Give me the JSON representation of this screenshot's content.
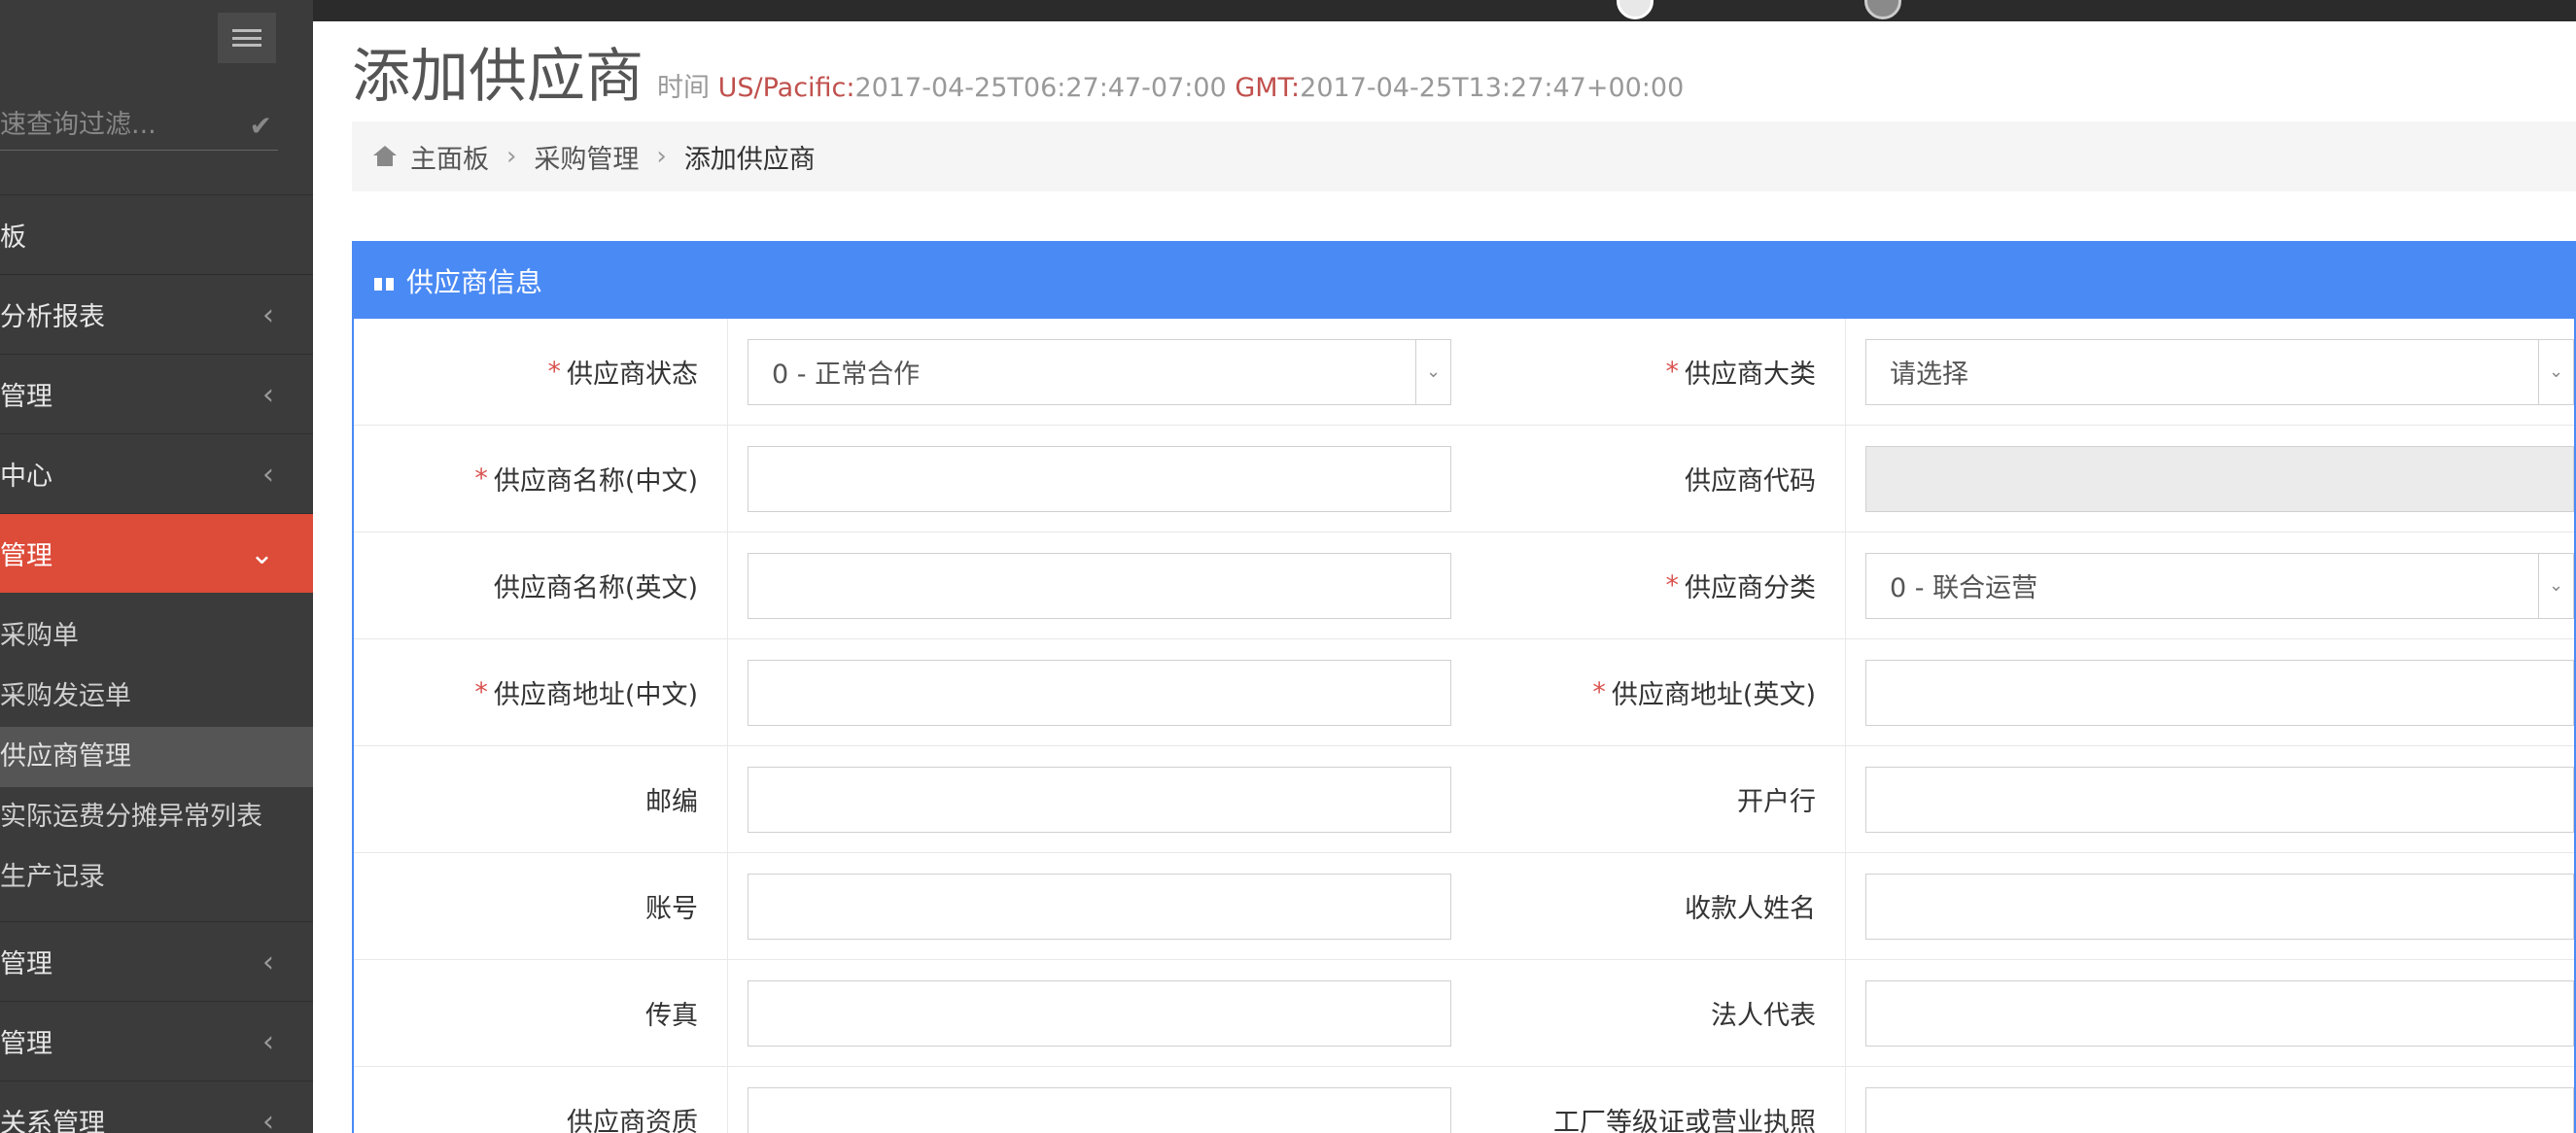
{
  "sidebar": {
    "search_placeholder": "速查询过滤...",
    "menu_top": [
      {
        "label": "板",
        "chevron": ""
      },
      {
        "label": "分析报表",
        "chevron": "‹"
      },
      {
        "label": "管理",
        "chevron": "‹"
      },
      {
        "label": "中心",
        "chevron": "‹"
      },
      {
        "label": "管理",
        "chevron": "⌄"
      }
    ],
    "submenu": [
      "采购单",
      "采购发运单",
      "供应商管理",
      "实际运费分摊异常列表",
      "生产记录"
    ],
    "menu_bottom": [
      {
        "label": "管理",
        "chevron": "‹"
      },
      {
        "label": "管理",
        "chevron": "‹"
      },
      {
        "label": "关系管理",
        "chevron": "‹"
      }
    ]
  },
  "header": {
    "title": "添加供应商",
    "time_label": "时间",
    "tz1_name": "US/Pacific:",
    "tz1_time": "2017-04-25T06:27:47-07:00",
    "tz2_name": "GMT:",
    "tz2_time": "2017-04-25T13:27:47+00:00"
  },
  "breadcrumb": {
    "home": "主面板",
    "level2": "采购管理",
    "current": "添加供应商",
    "separator": "›"
  },
  "panel": {
    "title": "供应商信息",
    "rows": [
      {
        "left_label": "供应商状态",
        "left_required": "*",
        "left_value": "0 - 正常合作",
        "right_label": "供应商大类",
        "right_required": "*",
        "right_value": "请选择"
      },
      {
        "left_label": "供应商名称(中文)",
        "left_required": "*",
        "left_value": "",
        "right_label": "供应商代码",
        "right_required": "",
        "right_value": ""
      },
      {
        "left_label": "供应商名称(英文)",
        "left_required": "",
        "left_value": "",
        "right_label": "供应商分类",
        "right_required": "*",
        "right_value": "0 - 联合运营"
      },
      {
        "left_label": "供应商地址(中文)",
        "left_required": "*",
        "left_value": "",
        "right_label": "供应商地址(英文)",
        "right_required": "*",
        "right_value": ""
      },
      {
        "left_label": "邮编",
        "left_required": "",
        "left_value": "",
        "right_label": "开户行",
        "right_required": "",
        "right_value": ""
      },
      {
        "left_label": "账号",
        "left_required": "",
        "left_value": "",
        "right_label": "收款人姓名",
        "right_required": "",
        "right_value": ""
      },
      {
        "left_label": "传真",
        "left_required": "",
        "left_value": "",
        "right_label": "法人代表",
        "right_required": "",
        "right_value": ""
      },
      {
        "left_label": "供应商资质",
        "left_required": "",
        "left_value": "",
        "right_label": "工厂等级证或营业执照",
        "right_required": "",
        "right_value": ""
      }
    ]
  },
  "colors": {
    "sidebar_bg": "#3b3b3b",
    "active_menu": "#dd4b39",
    "panel_head": "#4a8af4",
    "required": "#d9534f",
    "timezone": "#c0504d"
  }
}
